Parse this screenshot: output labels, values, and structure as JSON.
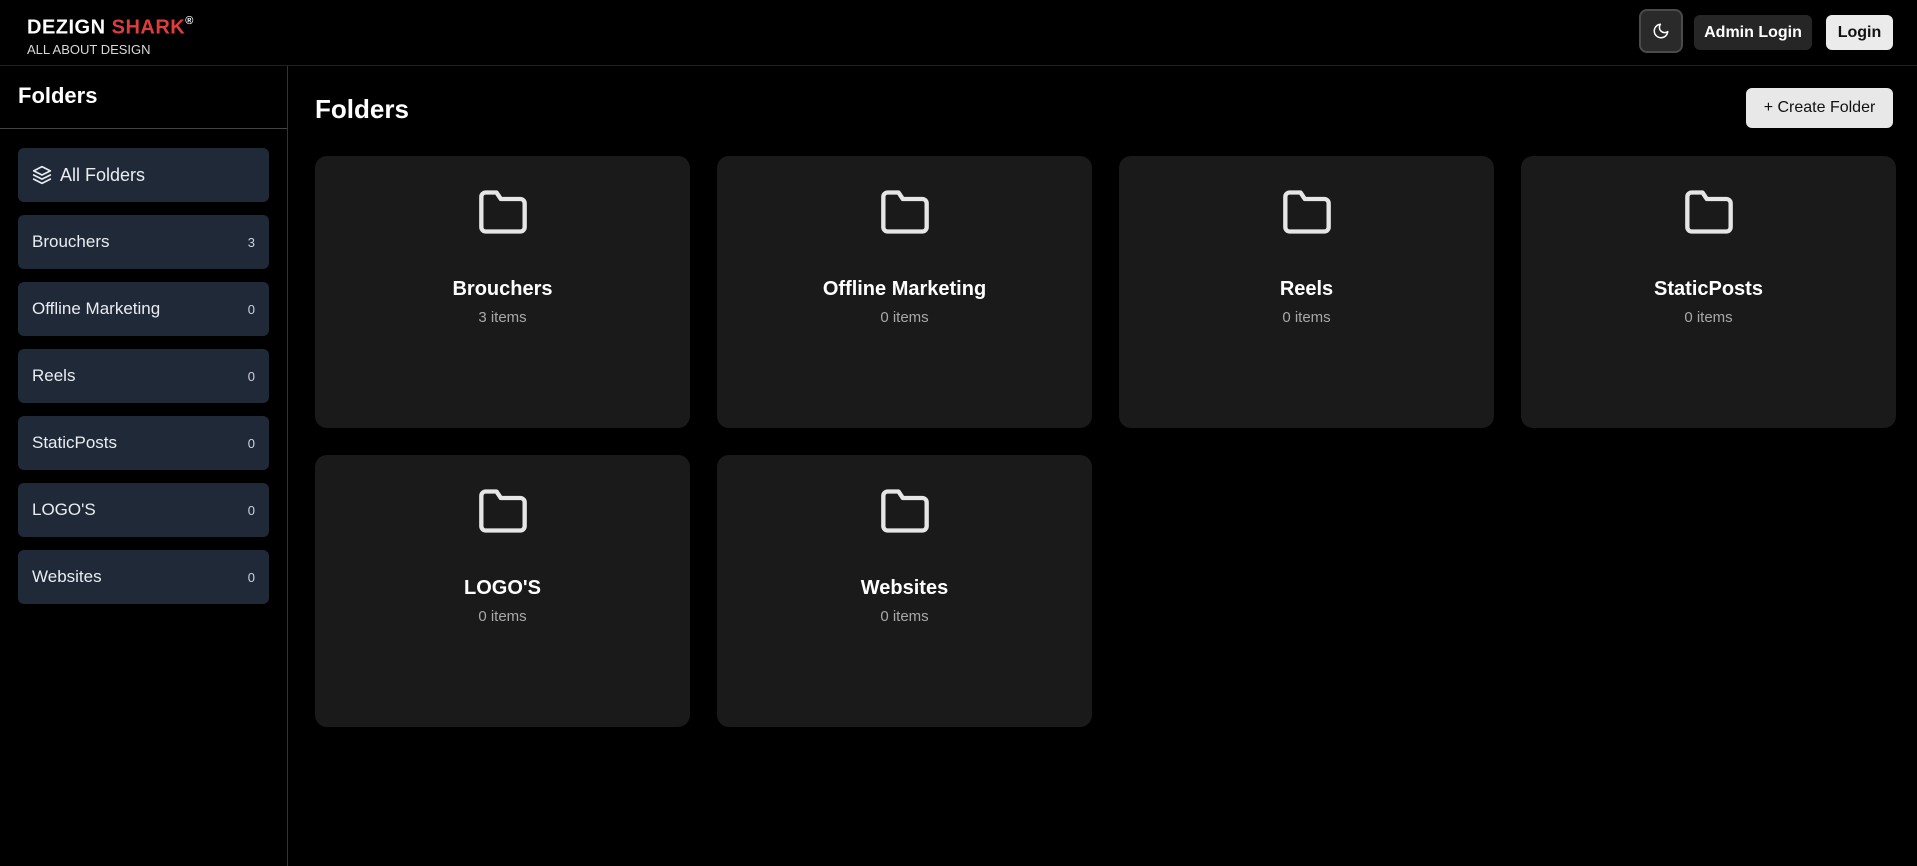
{
  "brand": {
    "name_part1": "DEZIGN ",
    "name_part2": "SHARK",
    "registered": "®",
    "tagline": "ALL ABOUT DESIGN"
  },
  "header": {
    "theme_icon": "moon-icon",
    "admin_login": "Admin Login",
    "login": "Login"
  },
  "sidebar": {
    "title": "Folders",
    "all_folders": {
      "label": "All Folders",
      "icon": "layers-icon"
    },
    "items": [
      {
        "label": "Brouchers",
        "count": "3"
      },
      {
        "label": "Offline Marketing",
        "count": "0"
      },
      {
        "label": "Reels",
        "count": "0"
      },
      {
        "label": "StaticPosts",
        "count": "0"
      },
      {
        "label": "LOGO'S",
        "count": "0"
      },
      {
        "label": "Websites",
        "count": "0"
      }
    ]
  },
  "main": {
    "title": "Folders",
    "create_button": "+ Create Folder",
    "folders": [
      {
        "name": "Brouchers",
        "items": "3 items",
        "icon": "folder-icon"
      },
      {
        "name": "Offline Marketing",
        "items": "0 items",
        "icon": "folder-icon"
      },
      {
        "name": "Reels",
        "items": "0 items",
        "icon": "folder-icon"
      },
      {
        "name": "StaticPosts",
        "items": "0 items",
        "icon": "folder-icon"
      },
      {
        "name": "LOGO'S",
        "items": "0 items",
        "icon": "folder-icon"
      },
      {
        "name": "Websites",
        "items": "0 items",
        "icon": "folder-icon"
      }
    ]
  },
  "colors": {
    "accent": "#e03c3c",
    "sidebar_item_bg": "#1f2937",
    "card_bg": "#1a1a1a",
    "background": "#000000"
  }
}
